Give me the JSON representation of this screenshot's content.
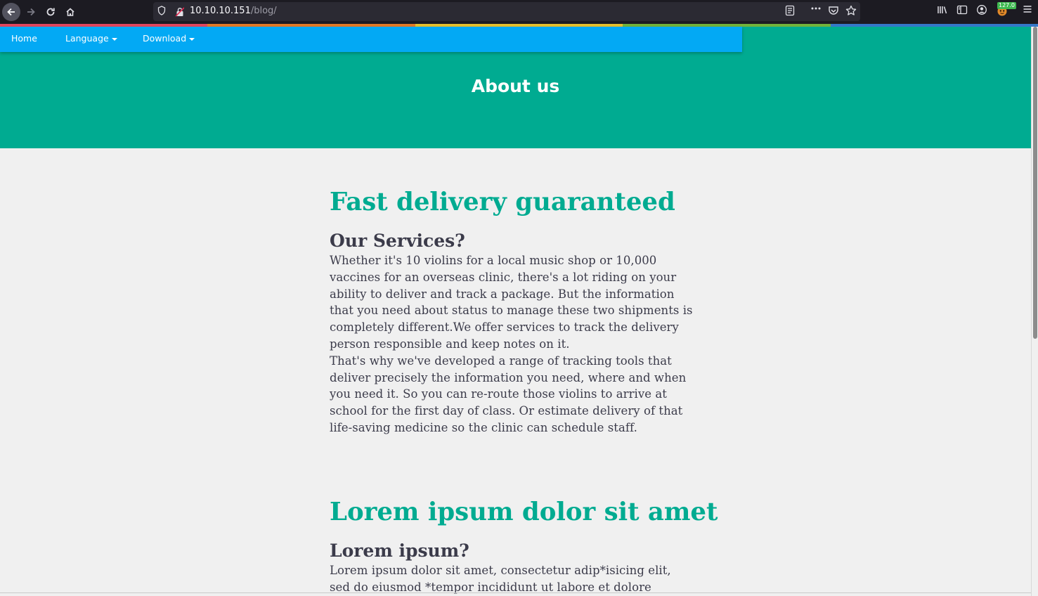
{
  "browser": {
    "url_host": "10.10.10.151",
    "url_path": "/blog/",
    "extension_badge": "127.0"
  },
  "rainbow_colors": [
    "#e2465d",
    "#e37a26",
    "#e6c02d",
    "#72b33a",
    "#3578c9"
  ],
  "nav": {
    "home": "Home",
    "language": "Language",
    "download": "Download"
  },
  "hero": {
    "title": "About us"
  },
  "sections": [
    {
      "heading": "Fast delivery guaranteed",
      "subheading": "Our Services?",
      "paragraph1": "Whether it's 10 violins for a local music shop or 10,000 vaccines for an overseas clinic, there's a lot riding on your ability to deliver and track a package. But the information that you need about status to manage these two shipments is completely different.We offer services to track the delivery person responsible and keep notes on it.",
      "paragraph2": "That's why we've developed a range of tracking tools that deliver precisely the information you need, where and when you need it. So you can re-route those violins to arrive at school for the first day of class. Or estimate delivery of that life-saving medicine so the clinic can schedule staff."
    },
    {
      "heading": "Lorem ipsum dolor sit amet",
      "subheading": "Lorem ipsum?",
      "paragraph1": "Lorem ipsum dolor sit amet, consectetur adip*isicing elit, sed do eiusmod *tempor incididunt ut labore et dolore"
    }
  ],
  "colors": {
    "accent_green": "#00ab91",
    "nav_blue": "#03a9f4",
    "text_dark": "#3b3b4a"
  }
}
